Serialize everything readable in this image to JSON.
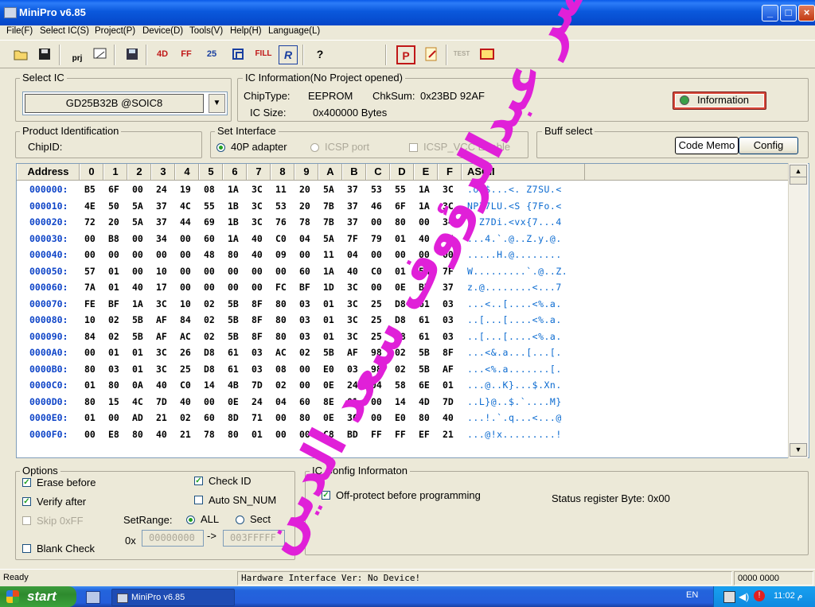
{
  "window": {
    "title": "MiniPro v6.85",
    "min": "_",
    "max": "□",
    "close": "×"
  },
  "menu": [
    "File(F)",
    "Select IC(S)",
    "Project(P)",
    "Device(D)",
    "Tools(V)",
    "Help(H)",
    "Language(L)"
  ],
  "toolbar": {
    "open_icon": "folder-open-icon",
    "save_icon": "floppy-save-icon",
    "prj": "prj",
    "fill": "FILL",
    "r": "R",
    "help": "?",
    "p": "P",
    "test": "TEST"
  },
  "select_ic": {
    "title": "Select IC",
    "value": "GD25B32B @SOIC8",
    "dropdown": "▼"
  },
  "ic_info": {
    "title": "IC Information(No Project opened)",
    "chiptype_label": "ChipType:",
    "chiptype": "EEPROM",
    "chksum_label": "ChkSum:",
    "chksum": "0x23BD 92AF",
    "icsize_label": "IC Size:",
    "icsize": "0x400000 Bytes",
    "info_button": "Information"
  },
  "product": {
    "title": "Product Identification",
    "chipid_label": "ChipID:"
  },
  "interface": {
    "title": "Set Interface",
    "adapter": "40P adapter",
    "icsp": "ICSP port",
    "icsp_vcc": "ICSP_VCC Enable"
  },
  "buff": {
    "title": "Buff select",
    "code_memo": "Code Memo",
    "config": "Config"
  },
  "hex": {
    "headers": [
      "Address",
      "0",
      "1",
      "2",
      "3",
      "4",
      "5",
      "6",
      "7",
      "8",
      "9",
      "A",
      "B",
      "C",
      "D",
      "E",
      "F",
      "ASCII"
    ],
    "rows": [
      {
        "addr": "000000:",
        "bytes": [
          "B5",
          "6F",
          "00",
          "24",
          "19",
          "08",
          "1A",
          "3C",
          "11",
          "20",
          "5A",
          "37",
          "53",
          "55",
          "1A",
          "3C"
        ],
        "ascii": ".o.$...<. Z7SU.<"
      },
      {
        "addr": "000010:",
        "bytes": [
          "4E",
          "50",
          "5A",
          "37",
          "4C",
          "55",
          "1B",
          "3C",
          "53",
          "20",
          "7B",
          "37",
          "46",
          "6F",
          "1A",
          "3C"
        ],
        "ascii": "NPZ7LU.<S {7Fo.<"
      },
      {
        "addr": "000020:",
        "bytes": [
          "72",
          "20",
          "5A",
          "37",
          "44",
          "69",
          "1B",
          "3C",
          "76",
          "78",
          "7B",
          "37",
          "00",
          "80",
          "00",
          "34"
        ],
        "ascii": "r Z7Di.<vx{7...4"
      },
      {
        "addr": "000030:",
        "bytes": [
          "00",
          "B8",
          "00",
          "34",
          "00",
          "60",
          "1A",
          "40",
          "C0",
          "04",
          "5A",
          "7F",
          "79",
          "01",
          "40",
          "17"
        ],
        "ascii": "...4.`.@..Z.y.@."
      },
      {
        "addr": "000040:",
        "bytes": [
          "00",
          "00",
          "00",
          "00",
          "00",
          "48",
          "80",
          "40",
          "09",
          "00",
          "11",
          "04",
          "00",
          "00",
          "00",
          "00"
        ],
        "ascii": ".....H.@........"
      },
      {
        "addr": "000050:",
        "bytes": [
          "57",
          "01",
          "00",
          "10",
          "00",
          "00",
          "00",
          "00",
          "00",
          "60",
          "1A",
          "40",
          "C0",
          "01",
          "5A",
          "7F"
        ],
        "ascii": "W.........`.@..Z."
      },
      {
        "addr": "000060:",
        "bytes": [
          "7A",
          "01",
          "40",
          "17",
          "00",
          "00",
          "00",
          "00",
          "FC",
          "BF",
          "1D",
          "3C",
          "00",
          "0E",
          "BD",
          "37"
        ],
        "ascii": "z.@........<...7"
      },
      {
        "addr": "000070:",
        "bytes": [
          "FE",
          "BF",
          "1A",
          "3C",
          "10",
          "02",
          "5B",
          "8F",
          "80",
          "03",
          "01",
          "3C",
          "25",
          "D8",
          "61",
          "03"
        ],
        "ascii": "...<..[....<%.a."
      },
      {
        "addr": "000080:",
        "bytes": [
          "10",
          "02",
          "5B",
          "AF",
          "84",
          "02",
          "5B",
          "8F",
          "80",
          "03",
          "01",
          "3C",
          "25",
          "D8",
          "61",
          "03"
        ],
        "ascii": "..[...[....<%.a."
      },
      {
        "addr": "000090:",
        "bytes": [
          "84",
          "02",
          "5B",
          "AF",
          "AC",
          "02",
          "5B",
          "8F",
          "80",
          "03",
          "01",
          "3C",
          "25",
          "D8",
          "61",
          "03"
        ],
        "ascii": "..[...[....<%.a."
      },
      {
        "addr": "0000A0:",
        "bytes": [
          "00",
          "01",
          "01",
          "3C",
          "26",
          "D8",
          "61",
          "03",
          "AC",
          "02",
          "5B",
          "AF",
          "98",
          "02",
          "5B",
          "8F"
        ],
        "ascii": "...<&.a...[...[."
      },
      {
        "addr": "0000B0:",
        "bytes": [
          "80",
          "03",
          "01",
          "3C",
          "25",
          "D8",
          "61",
          "03",
          "08",
          "00",
          "E0",
          "03",
          "98",
          "02",
          "5B",
          "AF"
        ],
        "ascii": "...<%.a.......[."
      },
      {
        "addr": "0000C0:",
        "bytes": [
          "01",
          "80",
          "0A",
          "40",
          "C0",
          "14",
          "4B",
          "7D",
          "02",
          "00",
          "0E",
          "24",
          "04",
          "58",
          "6E",
          "01"
        ],
        "ascii": "...@..K}...$.Xn."
      },
      {
        "addr": "0000D0:",
        "bytes": [
          "80",
          "15",
          "4C",
          "7D",
          "40",
          "00",
          "0E",
          "24",
          "04",
          "60",
          "8E",
          "01",
          "00",
          "14",
          "4D",
          "7D"
        ],
        "ascii": "..L}@..$.`....M}"
      },
      {
        "addr": "0000E0:",
        "bytes": [
          "01",
          "00",
          "AD",
          "21",
          "02",
          "60",
          "8D",
          "71",
          "00",
          "80",
          "0E",
          "3C",
          "00",
          "E0",
          "80",
          "40"
        ],
        "ascii": "...!.`.q...<...@"
      },
      {
        "addr": "0000F0:",
        "bytes": [
          "00",
          "E8",
          "80",
          "40",
          "21",
          "78",
          "80",
          "01",
          "00",
          "00",
          "C8",
          "BD",
          "FF",
          "FF",
          "EF",
          "21"
        ],
        "ascii": "...@!x.........!"
      }
    ]
  },
  "options": {
    "title": "Options",
    "erase_before": "Erase before",
    "verify_after": "Verify after",
    "skip_0xff": "Skip 0xFF",
    "blank_check": "Blank Check",
    "check_id": "Check ID",
    "auto_sn": "Auto SN_NUM",
    "setrange": "SetRange:",
    "all": "ALL",
    "sect": "Sect",
    "prefix": "0x",
    "range_start": "00000000",
    "arrow": "->",
    "range_end": "003FFFFF"
  },
  "icconfig": {
    "title": "IC Config Informaton",
    "off_protect": "Off-protect before programming",
    "status_reg": "Status register Byte: 0x00"
  },
  "statusbar": {
    "ready": "Ready",
    "hw": "Hardware Interface Ver: No Device!",
    "right": "0000 0000"
  },
  "taskbar": {
    "start": "start",
    "app": "MiniPro v6.85",
    "lang": "EN",
    "clock": "11:02 م"
  },
  "watermark": {
    "text": "مصر عبدالرؤوف سعد الدين"
  },
  "colors": {
    "xp_blue": "#0a58dc",
    "watermark": "#e020d8",
    "addr": "#0f45c8",
    "ascii": "#0a6ad0"
  }
}
